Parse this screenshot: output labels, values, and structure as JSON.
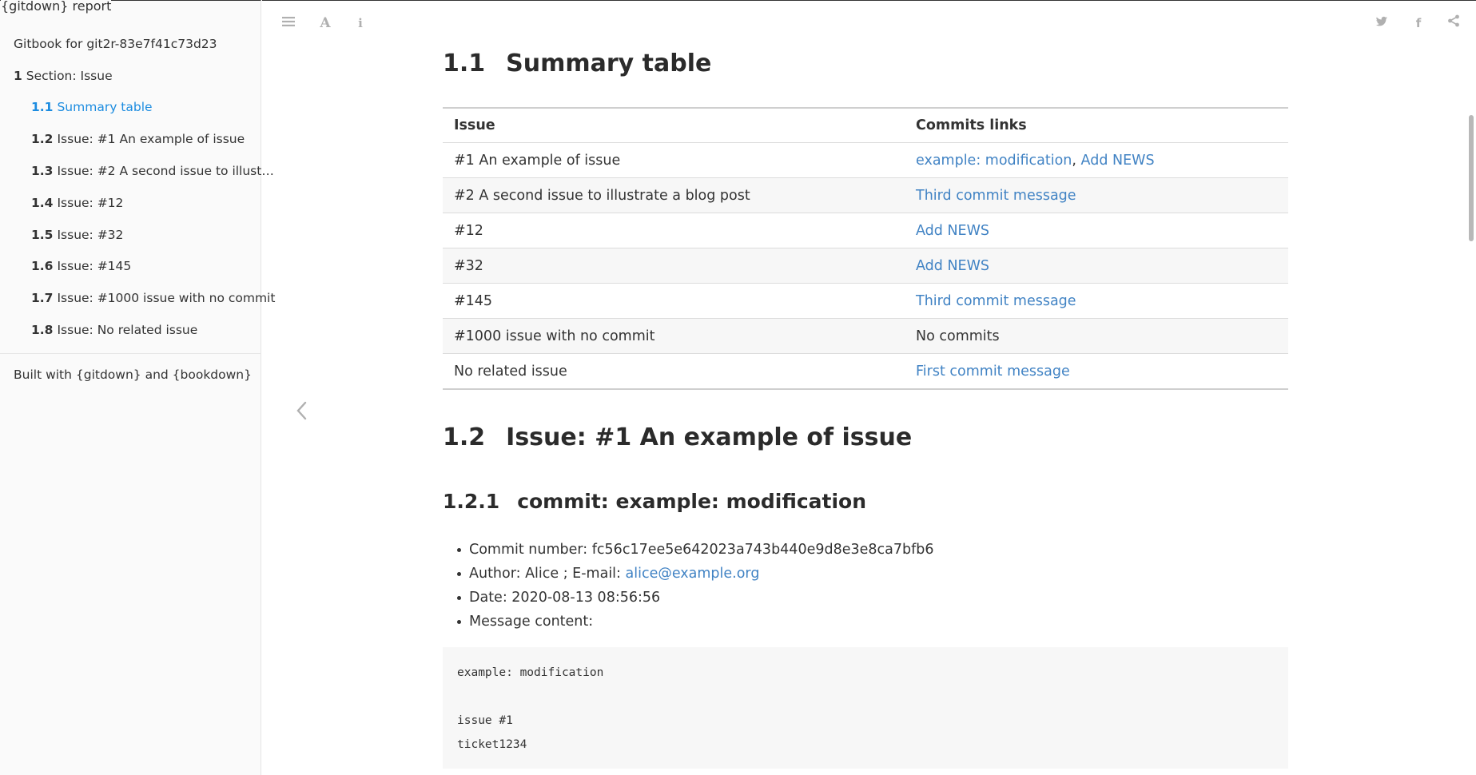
{
  "window": {
    "title": "{gitdown} report"
  },
  "sidebar": {
    "book_title": "Gitbook for git2r-83e7f41c73d23",
    "items": [
      {
        "num": "1",
        "label": "Section: Issue",
        "level": 1,
        "active": false
      },
      {
        "num": "1.1",
        "label": "Summary table",
        "level": 2,
        "active": true
      },
      {
        "num": "1.2",
        "label": "Issue: #1 An example of issue",
        "level": 2,
        "active": false
      },
      {
        "num": "1.3",
        "label": "Issue: #2 A second issue to illust…",
        "level": 2,
        "active": false
      },
      {
        "num": "1.4",
        "label": "Issue: #12",
        "level": 2,
        "active": false
      },
      {
        "num": "1.5",
        "label": "Issue: #32",
        "level": 2,
        "active": false
      },
      {
        "num": "1.6",
        "label": "Issue: #145",
        "level": 2,
        "active": false
      },
      {
        "num": "1.7",
        "label": "Issue: #1000 issue with no commit",
        "level": 2,
        "active": false
      },
      {
        "num": "1.8",
        "label": "Issue: No related issue",
        "level": 2,
        "active": false
      }
    ],
    "footer": "Built with {gitdown} and {bookdown}"
  },
  "toolbar": {
    "left_icons": [
      "menu-icon",
      "font-icon",
      "info-icon"
    ],
    "right_icons": [
      "twitter-icon",
      "facebook-icon",
      "share-icon"
    ]
  },
  "content": {
    "section_1_1": {
      "num": "1.1",
      "title": "Summary table"
    },
    "table": {
      "headers": [
        "Issue",
        "Commits links"
      ],
      "rows": [
        {
          "issue": "#1 An example of issue",
          "links": [
            "example: modification",
            "Add NEWS"
          ]
        },
        {
          "issue": "#2 A second issue to illustrate a blog post",
          "links": [
            "Third commit message"
          ]
        },
        {
          "issue": "#12",
          "links": [
            "Add NEWS"
          ]
        },
        {
          "issue": "#32",
          "links": [
            "Add NEWS"
          ]
        },
        {
          "issue": "#145",
          "links": [
            "Third commit message"
          ]
        },
        {
          "issue": "#1000 issue with no commit",
          "text": "No commits"
        },
        {
          "issue": "No related issue",
          "links": [
            "First commit message"
          ]
        }
      ]
    },
    "section_1_2": {
      "num": "1.2",
      "title": "Issue: #1 An example of issue"
    },
    "section_1_2_1": {
      "num": "1.2.1",
      "title": "commit: example: modification"
    },
    "commit": {
      "number_label": "Commit number: ",
      "number": "fc56c17ee5e642023a743b440e9d8e3e8ca7bfb6",
      "author_label": "Author: Alice ; E-mail: ",
      "email": "alice@example.org",
      "date_label": "Date: ",
      "date": "2020-08-13 08:56:56",
      "message_label": "Message content:",
      "message_lines": [
        "example: modification",
        "",
        "issue #1",
        "ticket1234"
      ]
    }
  },
  "colors": {
    "link": "#4183c4",
    "active": "#1c8ce0",
    "icon": "#b0b0b0"
  }
}
